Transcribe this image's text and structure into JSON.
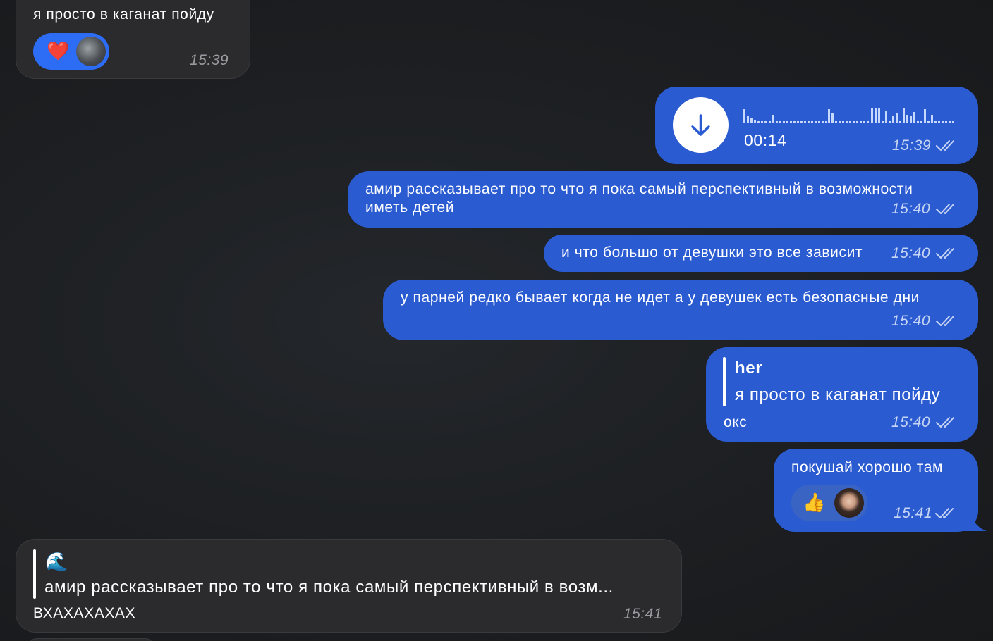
{
  "messages": [
    {
      "id": "m1",
      "direction": "incoming",
      "text": "я просто в каганат пойду",
      "time": "15:39",
      "reaction": {
        "emoji": "❤️",
        "icon": "heart-icon"
      }
    },
    {
      "id": "m2",
      "direction": "outgoing",
      "type": "voice",
      "duration": "00:14",
      "time": "15:39",
      "read": true,
      "action_icon": "download-arrow-icon"
    },
    {
      "id": "m3",
      "direction": "outgoing",
      "line1": "амир рассказывает про то что я пока самый перспективный в возможности",
      "line2": "иметь детей",
      "time": "15:40",
      "read": true
    },
    {
      "id": "m4",
      "direction": "outgoing",
      "text": "и что большо от девушки это все зависит",
      "time": "15:40",
      "read": true
    },
    {
      "id": "m5",
      "direction": "outgoing",
      "text": "у парней редко бывает когда не идет а у девушек есть безопасные дни",
      "time": "15:40",
      "read": true
    },
    {
      "id": "m6",
      "direction": "outgoing",
      "reply_author": "her",
      "reply_text": "я просто в каганат пойду",
      "text": "окс",
      "time": "15:40",
      "read": true
    },
    {
      "id": "m7",
      "direction": "outgoing",
      "text": "покушай хорошо там",
      "time": "15:41",
      "read": true,
      "reaction": {
        "emoji": "👍",
        "icon": "thumbs-up-icon"
      }
    },
    {
      "id": "m8",
      "direction": "incoming",
      "reply_author_emoji": "🌊",
      "reply_text": "амир рассказывает про то что я пока самый перспективный в возм...",
      "text": "ВХАХАХАХАХ",
      "time": "15:41"
    }
  ],
  "colors": {
    "background": "#1b1d20",
    "incoming_bubble": "#2b2b2e",
    "outgoing_bubble": "#2a5bd0",
    "reaction_pill_blue": "#2d6df6",
    "reaction_pill_dark": "#3a64c4"
  }
}
